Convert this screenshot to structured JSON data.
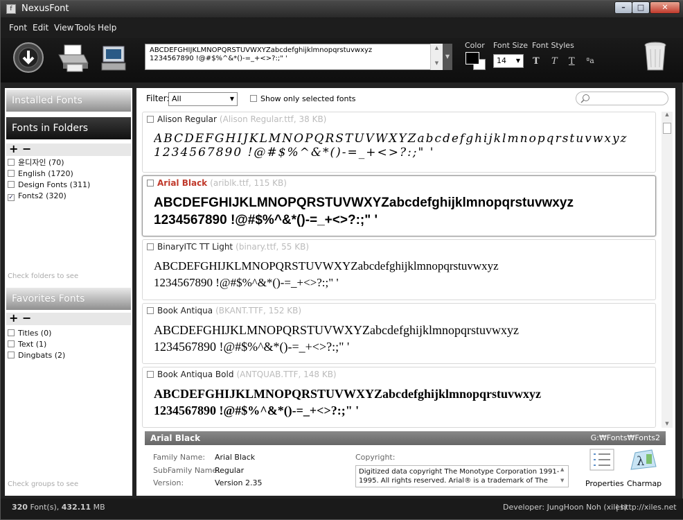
{
  "window": {
    "title": "NexusFont"
  },
  "menu": [
    "Font",
    "Edit",
    "View",
    "Tools",
    "Help"
  ],
  "toolbar": {
    "sample_text_line1": "ABCDEFGHIJKLMNOPQRSTUVWXYZabcdefghijklmnopqrstuvwxyz",
    "sample_text_line2": "1234567890 !@#$%^&*()-=_+<>?:;\" '",
    "color_label": "Color",
    "font_size_label": "Font Size",
    "font_size_value": "14",
    "font_styles_label": "Font Styles",
    "style_buttons": [
      "T",
      "T",
      "T",
      "ªa"
    ]
  },
  "left": {
    "installed_fonts": "Installed Fonts",
    "fonts_in_folders": "Fonts in Folders",
    "folders": [
      {
        "label": "윤디자인 (70)",
        "checked": false
      },
      {
        "label": "English (1720)",
        "checked": false
      },
      {
        "label": "Design Fonts (311)",
        "checked": false
      },
      {
        "label": "Fonts2 (320)",
        "checked": true
      }
    ],
    "folders_hint": "Check folders to see",
    "favorites_fonts": "Favorites Fonts",
    "groups": [
      {
        "label": "Titles (0)",
        "checked": false
      },
      {
        "label": "Text (1)",
        "checked": false
      },
      {
        "label": "Dingbats (2)",
        "checked": false
      }
    ],
    "groups_hint": "Check groups to see"
  },
  "filter": {
    "label": "Filter:",
    "value": "All",
    "show_selected": "Show only selected fonts"
  },
  "fonts": [
    {
      "name": "Alison Regular",
      "meta": "(Alison Regular.ttf, 38 KB)",
      "l1": "ABCDEFGHIJKLMNOPQRSTUVWXYZabcdefghijklmnopqrstuvwxyz",
      "l2": "1234567890 !@#$%^&*()-=_+<>?:;\" '",
      "selected": false
    },
    {
      "name": "Arial Black",
      "meta": "(ariblk.ttf, 115 KB)",
      "l1": "ABCDEFGHIJKLMNOPQRSTUVWXYZabcdefghijklmnopqrstuvwxyz",
      "l2": "1234567890 !@#$%^&*()-=_+<>?:;\" '",
      "selected": true
    },
    {
      "name": "BinaryITC TT Light",
      "meta": "(binary.ttf, 55 KB)",
      "l1": "ABCDEFGHIJKLMNOPQRSTUVWXYZabcdefghijklmnopqrstuvwxyz",
      "l2": "1234567890 !@#$%^&*()-=_+<>?:;\" '",
      "selected": false
    },
    {
      "name": "Book Antiqua",
      "meta": "(BKANT.TTF, 152 KB)",
      "l1": "ABCDEFGHIJKLMNOPQRSTUVWXYZabcdefghijklmnopqrstuvwxyz",
      "l2": "1234567890 !@#$%^&*()-=_+<>?:;\" '",
      "selected": false
    },
    {
      "name": "Book Antiqua Bold",
      "meta": "(ANTQUAB.TTF, 148 KB)",
      "l1": "ABCDEFGHIJKLMNOPQRSTUVWXYZabcdefghijklmnopqrstuvwxyz",
      "l2": "1234567890 !@#$%^&*()-=_+<>?:;\" '",
      "selected": false
    }
  ],
  "info": {
    "name": "Arial Black",
    "path": "G:₩Fonts₩Fonts2",
    "family_label": "Family Name:",
    "family": "Arial Black",
    "subfamily_label": "SubFamily Name:",
    "subfamily": "Regular",
    "version_label": "Version:",
    "version": "Version 2.35",
    "copyright_label": "Copyright:",
    "copyright": "Digitized data copyright The Monotype Corporation 1991-1995. All rights reserved. Arial® is a trademark of The",
    "properties": "Properties",
    "charmap": "Charmap"
  },
  "status": {
    "count": "320",
    "count_suffix": " Font(s), ",
    "size": "432.11",
    "size_unit": " MB",
    "developer": "Developer: JungHoon Noh (xiles)",
    "url": "| http://xiles.net"
  }
}
